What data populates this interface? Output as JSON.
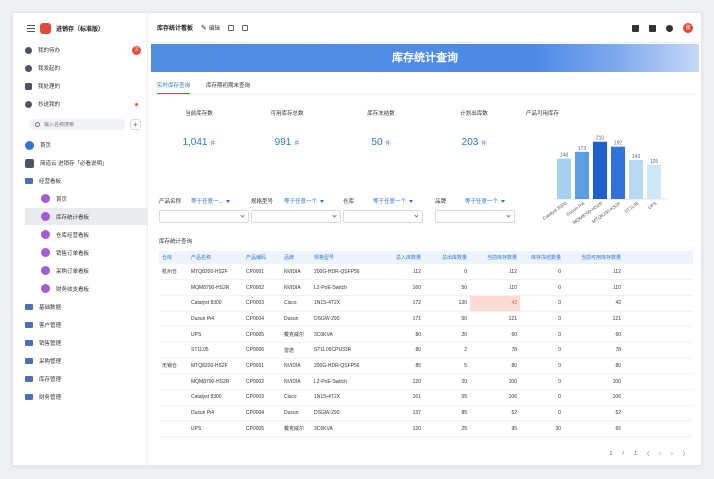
{
  "app": {
    "title": "进销存（标准版）"
  },
  "sidebar": {
    "items": [
      {
        "label": "我的待办",
        "badge": "3"
      },
      {
        "label": "我发起的"
      },
      {
        "label": "我处理的"
      },
      {
        "label": "抄送我的"
      }
    ],
    "search_placeholder": "输入名称搜索",
    "home": "首页",
    "guide": "简道云 进销存「必看说明」",
    "group_open": "经营看板",
    "sub_items": [
      "首页",
      "库存统计看板",
      "仓库经营看板",
      "销售订单看板",
      "采购订单看板",
      "财务收支看板"
    ],
    "groups": [
      "基础数据",
      "客户管理",
      "销售管理",
      "采购管理",
      "库存管理",
      "财务管理"
    ]
  },
  "topbar": {
    "title": "库存统计看板",
    "edit": "编辑"
  },
  "banner": {
    "title": "库存统计查询"
  },
  "tabs": [
    "实时库存查询",
    "库存期初期末查询"
  ],
  "stats": [
    {
      "label": "当前库存数",
      "value": "1,041",
      "unit": "件"
    },
    {
      "label": "可用库存总数",
      "value": "991",
      "unit": "件"
    },
    {
      "label": "库存冻结数",
      "value": "50",
      "unit": "件"
    },
    {
      "label": "计划出库数",
      "value": "203",
      "unit": "件"
    }
  ],
  "chart_data": {
    "type": "bar",
    "title": "产品可用库存",
    "categories": [
      "Catalyst 8300",
      "Dusun Pi4",
      "MQM8790-HS2R",
      "MTQ8200-HS2F",
      "ST1L05",
      "UPS"
    ],
    "values": [
      148,
      173,
      210,
      192,
      143,
      125
    ],
    "ylim": [
      0,
      220
    ],
    "colors": [
      "#a8d0f0",
      "#5d9ee0",
      "#1f5fc9",
      "#2f74d6",
      "#b9daf3",
      "#cfe8f8"
    ]
  },
  "filters": [
    {
      "label": "产品名称",
      "value": "等于任意一..."
    },
    {
      "label": "规格型号",
      "value": "等于任意一个"
    },
    {
      "label": "仓库",
      "value": "等于任意一个"
    },
    {
      "label": "品牌",
      "value": "等于任意一个"
    }
  ],
  "table": {
    "title": "库存统计查询",
    "columns": [
      "仓库",
      "产品名称",
      "产品编码",
      "品牌",
      "规格型号",
      "总入库数量",
      "总出库数量",
      "当前库存数量",
      "库存冻结数量",
      "当前可用库存数量"
    ],
    "rows": [
      [
        "杭州仓",
        "MTQ8200-HS2F",
        "CP0001",
        "NVIDIA",
        "200G-HDR-QSFP56",
        "112",
        "0",
        "112",
        "0",
        "112"
      ],
      [
        "",
        "MQM8790-HS2R",
        "CP0002",
        "NVIDIA",
        "L2-PoE-Switch",
        "160",
        "50",
        "110",
        "0",
        "110"
      ],
      [
        "",
        "Catalyst 8300",
        "CP0003",
        "Cisco",
        "1N1S-4T2X",
        "172",
        "130",
        "42",
        "0",
        "42"
      ],
      [
        "",
        "Dusun Pi4",
        "CP0004",
        "Dusun",
        "DSGW-290",
        "171",
        "50",
        "121",
        "0",
        "121"
      ],
      [
        "",
        "UPS",
        "CP0005",
        "戴克威尔",
        "3C6KVA",
        "80",
        "20",
        "60",
        "0",
        "60"
      ],
      [
        "",
        "ST1L05",
        "CP0006",
        "雷迭",
        "ST1L05CPU33R",
        "80",
        "2",
        "78",
        "0",
        "78"
      ],
      [
        "无锡仓",
        "MTQ8200-HS2F",
        "CP0001",
        "NVIDIA",
        "200G-HDR-QSFP56",
        "85",
        "5",
        "80",
        "0",
        "80"
      ],
      [
        "",
        "MQM8790-HS2R",
        "CP0002",
        "NVIDIA",
        "L2-PoE-Switch",
        "120",
        "20",
        "100",
        "0",
        "100"
      ],
      [
        "",
        "Catalyst 8300",
        "CP0003",
        "Cisco",
        "1N1S-4T2X",
        "161",
        "55",
        "106",
        "0",
        "106"
      ],
      [
        "",
        "Dusun Pi4",
        "CP0004",
        "Dusun",
        "DSGW-290",
        "137",
        "85",
        "52",
        "0",
        "52"
      ],
      [
        "",
        "UPS",
        "CP0005",
        "戴克威尔",
        "3C6KVA",
        "120",
        "25",
        "95",
        "30",
        "65"
      ]
    ],
    "highlight_color": "#fbdbd2"
  },
  "pager": {
    "page": "1",
    "sep": "/",
    "total": "1"
  }
}
